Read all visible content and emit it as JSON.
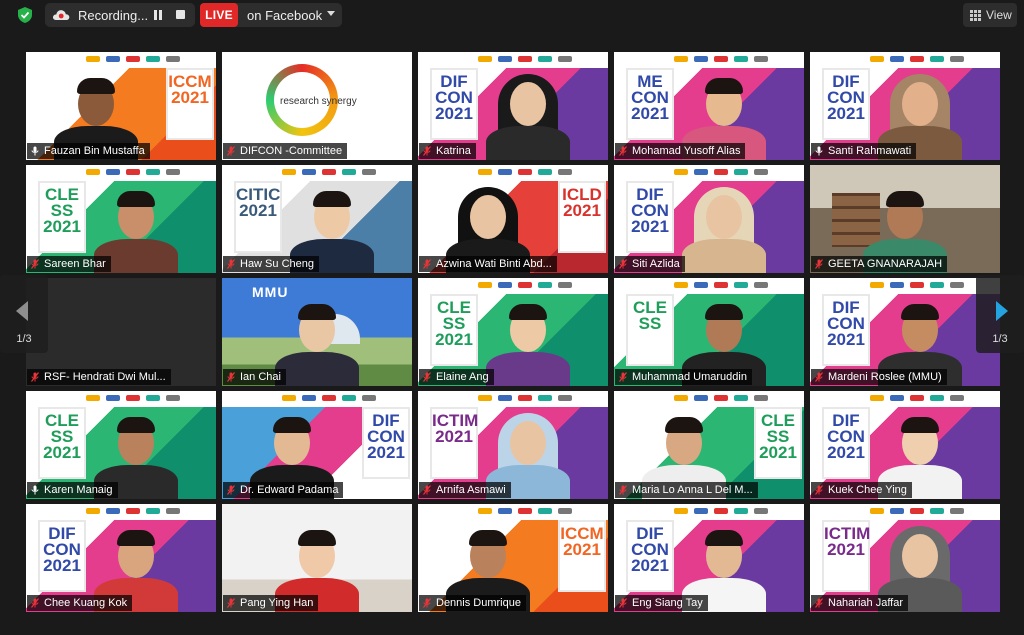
{
  "topbar": {
    "recording_label": "Recording...",
    "live_badge": "LIVE",
    "live_destination": "on Facebook",
    "view_label": "View"
  },
  "pagination": {
    "left_label": "1/3",
    "right_label": "1/3"
  },
  "colors": {
    "active_speaker_border": "#a6d64b",
    "live_red": "#e02828",
    "next_arrow": "#23a3e0",
    "muted_mic": "#e8343a"
  },
  "participants": [
    {
      "name": "Fauzan Bin Mustaffa",
      "muted": false,
      "banner": "ICCM 2021"
    },
    {
      "name": "DIFCON -Committee",
      "muted": true,
      "banner": "research synergy"
    },
    {
      "name": "Katrina",
      "muted": true,
      "banner": "DIF CON 2021"
    },
    {
      "name": "Mohamad Yusoff Alias",
      "muted": true,
      "banner": "ME CON 2021"
    },
    {
      "name": "Santi Rahmawati",
      "muted": false,
      "banner": "DIF CON 2021",
      "active": true
    },
    {
      "name": "Sareen Bhar",
      "muted": true,
      "banner": "CLE SS 2021"
    },
    {
      "name": "Haw Su Cheng",
      "muted": true,
      "banner": "CITIC 2021"
    },
    {
      "name": "Azwina Wati Binti Abd...",
      "muted": true,
      "banner": "ICLD 2021"
    },
    {
      "name": "Siti Azlida",
      "muted": true,
      "banner": "DIF CON 2021"
    },
    {
      "name": "GEETA GNANARAJAH",
      "muted": true,
      "banner": ""
    },
    {
      "name": "RSF- Hendrati Dwi Mul...",
      "muted": true,
      "banner": ""
    },
    {
      "name": "Ian Chai",
      "muted": true,
      "banner": "MMU"
    },
    {
      "name": "Elaine Ang",
      "muted": true,
      "banner": "CLE SS 2021"
    },
    {
      "name": "Muhammad Umaruddin",
      "muted": true,
      "banner": "CLE SS"
    },
    {
      "name": "Mardeni Roslee (MMU)",
      "muted": true,
      "banner": "DIF CON 2021"
    },
    {
      "name": "Karen Manaig",
      "muted": false,
      "banner": "CLE SS 2021"
    },
    {
      "name": "Dr. Edward Padama",
      "muted": true,
      "banner": "DIF CON 2021"
    },
    {
      "name": "Arnifa Asmawi",
      "muted": true,
      "banner": "ICTIM 2021"
    },
    {
      "name": "Maria Lo Anna L Del M...",
      "muted": true,
      "banner": "CLE SS 2021"
    },
    {
      "name": "Kuek Chee Ying",
      "muted": true,
      "banner": "DIF CON 2021"
    },
    {
      "name": "Chee Kuang Kok",
      "muted": true,
      "banner": "DIF CON 2021"
    },
    {
      "name": "Pang Ying Han",
      "muted": true,
      "banner": ""
    },
    {
      "name": "Dennis Dumrique",
      "muted": true,
      "banner": "ICCM 2021"
    },
    {
      "name": "Eng Siang Tay",
      "muted": true,
      "banner": "DIF CON 2021"
    },
    {
      "name": "Nahariah Jaffar",
      "muted": true,
      "banner": "ICTIM 2021"
    }
  ]
}
